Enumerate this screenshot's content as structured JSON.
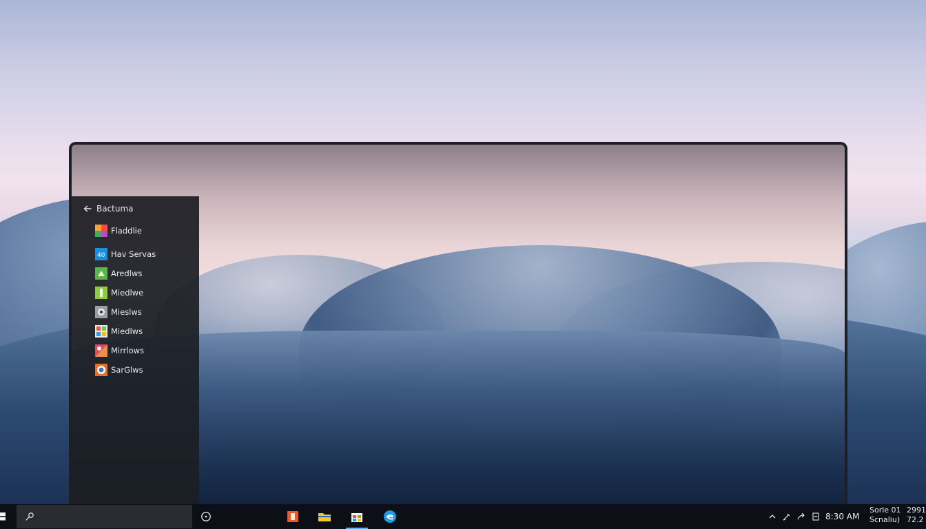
{
  "panel": {
    "title": "Bactuma",
    "back_icon": "back-arrow-icon",
    "apps": [
      {
        "label": "Fladdlie",
        "icon": "app-tile-orange-icon",
        "color": "#f06a2a"
      },
      {
        "label": "Hav Servas",
        "icon": "app-tile-blue-icon",
        "color": "#1a8fe0"
      },
      {
        "label": "Aredlws",
        "icon": "app-tile-green-icon",
        "color": "#5bb54a"
      },
      {
        "label": "Miedlwe",
        "icon": "app-tile-lime-icon",
        "color": "#8ccc3f"
      },
      {
        "label": "Mieslws",
        "icon": "app-tile-gray-icon",
        "color": "#9a9fa8"
      },
      {
        "label": "Miedlws",
        "icon": "app-tile-multicolor-icon",
        "color": "#e9e9e9"
      },
      {
        "label": "Mirrlows",
        "icon": "app-tile-red-icon",
        "color": "#e04a5a"
      },
      {
        "label": "SarGlws",
        "icon": "app-tile-orange-circle-icon",
        "color": "#e8701f"
      }
    ]
  },
  "taskbar": {
    "start_icon": "windows-start-icon",
    "search_icon": "search-icon",
    "taskview_icon": "task-view-icon",
    "pinned": [
      {
        "name": "office-icon",
        "color": "#ea5b1f"
      },
      {
        "name": "file-explorer-icon",
        "color": "#f4c629"
      },
      {
        "name": "store-icon",
        "color": "#2a8ee6"
      },
      {
        "name": "edge-browser-icon",
        "color": "#1f9ae8"
      }
    ],
    "tray": {
      "clock": "8:30 AM",
      "date_line1": "Sorle 01",
      "date_line2": "Scnaliu)",
      "extra_line1": "2991",
      "extra_line2": "72.2"
    }
  },
  "colors": {
    "panel_bg": "#1c1e24",
    "taskbar_bg": "#0c0f16",
    "accent": "#62aef0"
  }
}
